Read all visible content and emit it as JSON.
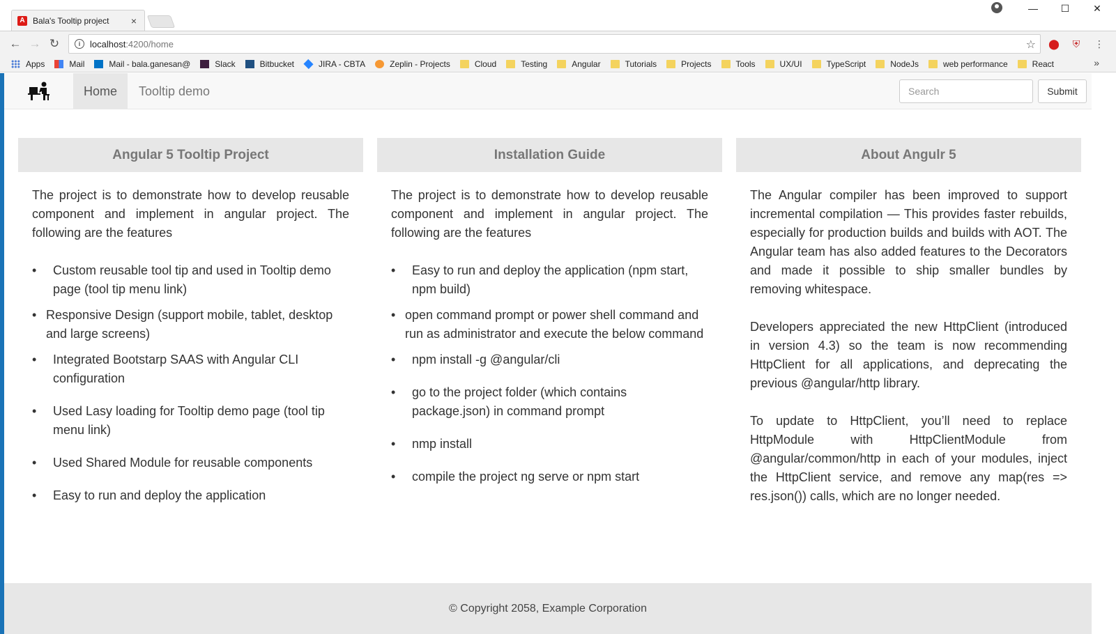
{
  "browser": {
    "tab_title": "Bala's Tooltip project",
    "tab_close": "×",
    "url_host": "localhost",
    "url_path": ":4200/home",
    "window_controls": [
      "—",
      "☐",
      "✕"
    ],
    "bookmarks": [
      {
        "label": "Apps",
        "icon": "apps-icon"
      },
      {
        "label": "Mail",
        "icon": "google-icon"
      },
      {
        "label": "Mail - bala.ganesan@",
        "icon": "outlook-icon"
      },
      {
        "label": "Slack",
        "icon": "slack-icon"
      },
      {
        "label": "Bitbucket",
        "icon": "bitbucket-icon"
      },
      {
        "label": "JIRA - CBTA",
        "icon": "jira-icon"
      },
      {
        "label": "Zeplin - Projects",
        "icon": "zeplin-icon"
      },
      {
        "label": "Cloud",
        "icon": "folder-icon"
      },
      {
        "label": "Testing",
        "icon": "folder-icon"
      },
      {
        "label": "Angular",
        "icon": "folder-icon"
      },
      {
        "label": "Tutorials",
        "icon": "folder-icon"
      },
      {
        "label": "Projects",
        "icon": "folder-icon"
      },
      {
        "label": "Tools",
        "icon": "folder-icon"
      },
      {
        "label": "UX/UI",
        "icon": "folder-icon"
      },
      {
        "label": "TypeScript",
        "icon": "folder-icon"
      },
      {
        "label": "NodeJs",
        "icon": "folder-icon"
      },
      {
        "label": "web performance",
        "icon": "folder-icon"
      },
      {
        "label": "React",
        "icon": "folder-icon"
      }
    ],
    "more": "»"
  },
  "navbar": {
    "links": [
      "Home",
      "Tooltip demo"
    ],
    "search_placeholder": "Search",
    "submit_label": "Submit"
  },
  "columns": [
    {
      "title": "Angular 5 Tooltip Project",
      "intro": "The project is to demonstrate how to develop reusable component and implement in angular project. The following are the features",
      "items": [
        "Custom reusable tool tip and used in Tooltip demo page (tool tip menu link)",
        "Responsive Design (support mobile, tablet, desktop and large screens)",
        "Integrated Bootstarp SAAS with Angular CLI configuration",
        "Used Lasy loading for Tooltip demo page (tool tip menu link)",
        "Used Shared Module for reusable components",
        "Easy to run and deploy the application"
      ]
    },
    {
      "title": "Installation Guide",
      "intro": "The project is to demonstrate how to develop reusable component and implement in angular project. The following are the features",
      "items": [
        "Easy to run and deploy the application (npm start, npm build)",
        "open command prompt or power shell command and run as administrator and execute the below command",
        "npm install -g @angular/cli",
        "go to the project folder (which contains package.json) in command prompt",
        "nmp install",
        "compile the project ng serve or npm start"
      ]
    },
    {
      "title": "About Angulr 5",
      "paragraphs": [
        "The Angular compiler has been improved to support incremental compilation — This provides faster rebuilds, especially for production builds and builds with AOT. The Angular team has also added features to the Decorators and made it possible to ship smaller bundles by removing whitespace.",
        "Developers appreciated the new HttpClient (introduced in version 4.3) so the team is now recommending HttpClient for all applications, and deprecating the previous @angular/http library.",
        "To update to HttpClient, you’ll need to replace HttpModule with HttpClientModule from @angular/common/http in each of your modules, inject the HttpClient service, and remove any map(res => res.json()) calls, which are no longer needed."
      ]
    }
  ],
  "footer": {
    "text": "© Copyright 2058, Example Corporation"
  }
}
